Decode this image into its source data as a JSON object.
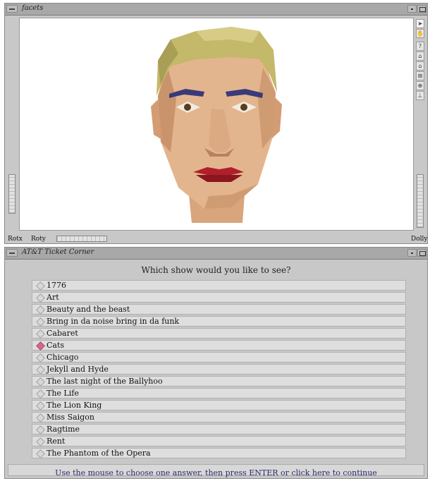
{
  "viewer": {
    "title": "facets",
    "bottom_labels": {
      "rotx": "Rotx",
      "roty": "Roty",
      "dolly": "Dolly"
    },
    "toolbar": [
      {
        "name": "pointer-arrow-icon",
        "glyph": "➤"
      },
      {
        "name": "hand-pan-icon",
        "glyph": "✋"
      },
      {
        "name": "help-question-icon",
        "glyph": "?"
      },
      {
        "name": "home-icon",
        "glyph": "⌂"
      },
      {
        "name": "set-home-icon",
        "glyph": "⌂"
      },
      {
        "name": "view-all-icon",
        "glyph": "⊞"
      },
      {
        "name": "seek-target-icon",
        "glyph": "⊕"
      },
      {
        "name": "perspective-camera-icon",
        "glyph": "⊥"
      }
    ]
  },
  "ticket": {
    "title": "AT&T Ticket Corner",
    "question": "Which show would you like to see?",
    "selected_index": 5,
    "options": [
      "1776",
      "Art",
      "Beauty and the beast",
      "Bring in da noise bring in da funk",
      "Cabaret",
      "Cats",
      "Chicago",
      "Jekyll and Hyde",
      "The last night of the Ballyhoo",
      "The Life",
      "The Lion King",
      "Miss Saigon",
      "Ragtime",
      "Rent",
      "The Phantom of the Opera"
    ],
    "continue_text": "Use the mouse to choose one answer, then press ENTER or click here to continue"
  },
  "colors": {
    "selected_radio": "#d06a8c",
    "skin": "#e3b58e",
    "hair": "#c4b86a",
    "lips": "#b0202a",
    "eyebrows": "#3a3a7a"
  }
}
